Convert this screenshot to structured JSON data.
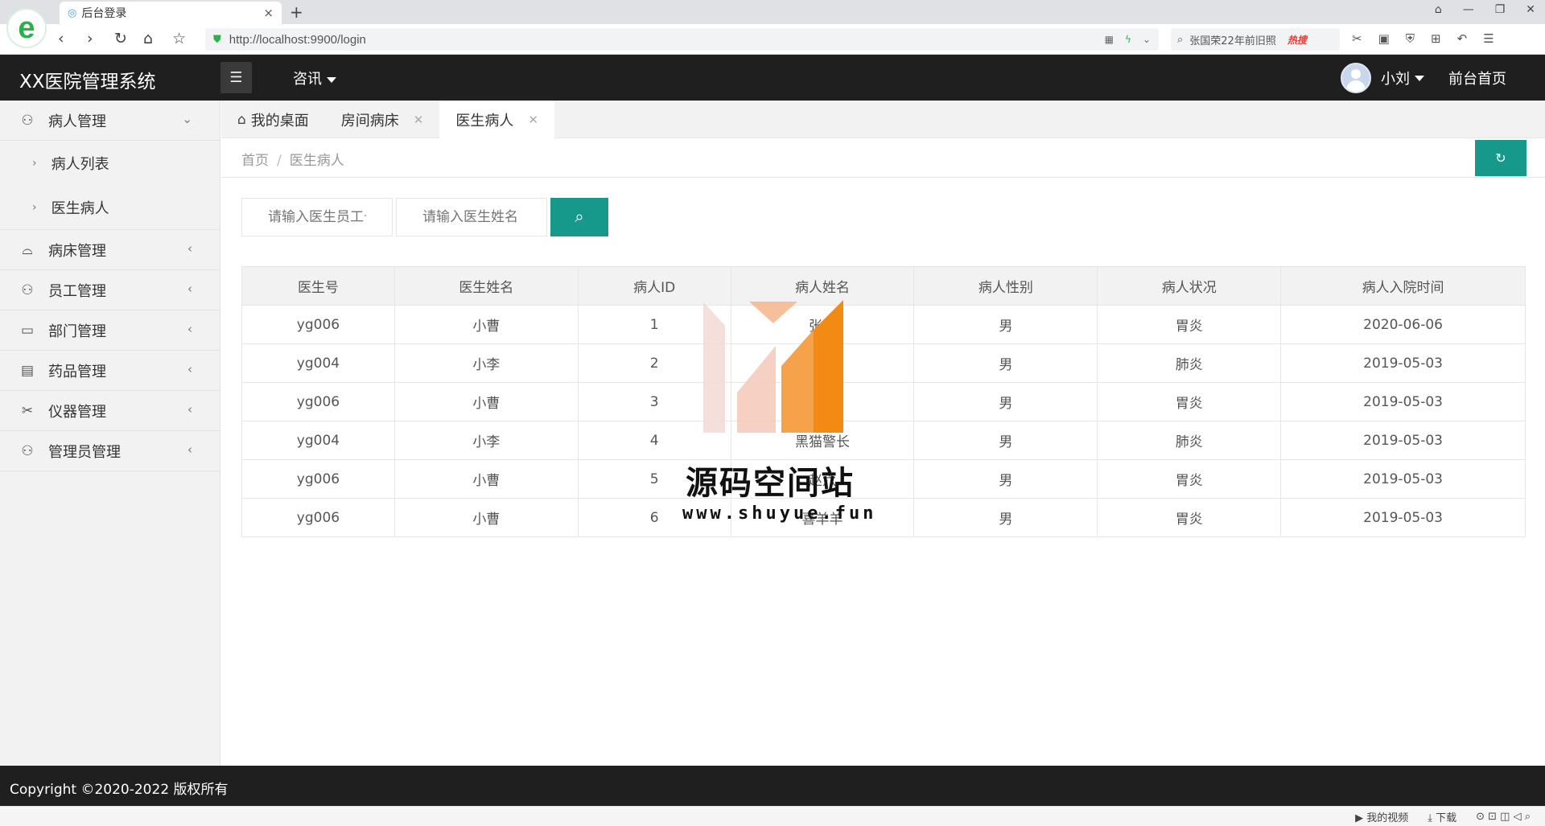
{
  "browser": {
    "tab_title": "后台登录",
    "tab_close": "×",
    "new_tab": "+",
    "url": "http://localhost:9900/login",
    "hot_search_text": "张国荣22年前旧照",
    "hot_tag": "热搜",
    "status_video": "我的视频",
    "status_download": "下载"
  },
  "header": {
    "logo": "XX医院管理系统",
    "nav_news": "咨讯",
    "user_name": "小刘",
    "front_home": "前台首页"
  },
  "sidebar": {
    "groups": [
      {
        "label": "病人管理",
        "sub": [
          "病人列表",
          "医生病人"
        ]
      },
      {
        "label": "病床管理"
      },
      {
        "label": "员工管理"
      },
      {
        "label": "部门管理"
      },
      {
        "label": "药品管理"
      },
      {
        "label": "仪器管理"
      },
      {
        "label": "管理员管理"
      }
    ]
  },
  "tabs": [
    {
      "label": "我的桌面"
    },
    {
      "label": "房间病床"
    },
    {
      "label": "医生病人"
    }
  ],
  "breadcrumb": {
    "home": "首页",
    "sep": "/",
    "current": "医生病人"
  },
  "search": {
    "staff_id_placeholder": "请输入医生员工号",
    "doctor_name_placeholder": "请输入医生姓名"
  },
  "table": {
    "headers": [
      "医生号",
      "医生姓名",
      "病人ID",
      "病人姓名",
      "病人性别",
      "病人状况",
      "病人入院时间"
    ],
    "rows": [
      [
        "yg006",
        "小曹",
        "1",
        "张三",
        "男",
        "胃炎",
        "2020-06-06"
      ],
      [
        "yg004",
        "小李",
        "2",
        "李四",
        "男",
        "肺炎",
        "2019-05-03"
      ],
      [
        "yg006",
        "小曹",
        "3",
        "王五",
        "男",
        "胃炎",
        "2019-05-03"
      ],
      [
        "yg004",
        "小李",
        "4",
        "黑猫警长",
        "男",
        "肺炎",
        "2019-05-03"
      ],
      [
        "yg006",
        "小曹",
        "5",
        "赵六",
        "男",
        "胃炎",
        "2019-05-03"
      ],
      [
        "yg006",
        "小曹",
        "6",
        "喜羊羊",
        "男",
        "胃炎",
        "2019-05-03"
      ]
    ]
  },
  "watermark": {
    "title": "源码空间站",
    "url": "www.shuyue.fun"
  },
  "footer": {
    "copyright": "Copyright ©2020-2022 版权所有"
  },
  "colors": {
    "primary": "#16998b",
    "header_bg": "#1f1f1f",
    "sidebar_bg": "#f2f2f2"
  }
}
